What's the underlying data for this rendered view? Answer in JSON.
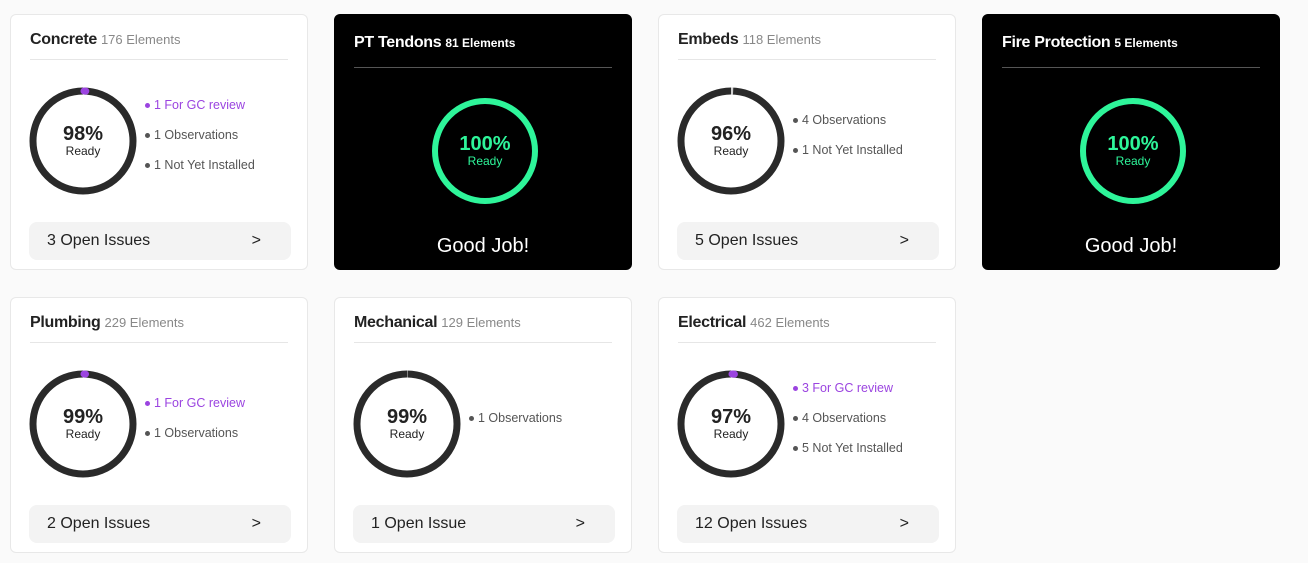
{
  "colors": {
    "track": "#2a2a2a",
    "gap": "#d0d0d0",
    "review": "#9b44e0",
    "good": "#2ef59a"
  },
  "cards": [
    {
      "title": "Concrete",
      "count": "176 Elements",
      "percent": "98%",
      "ready": "Ready",
      "ready_fraction": 0.98,
      "review_fraction": 0.006,
      "legend": [
        {
          "label": "1 For GC review",
          "type": "review"
        },
        {
          "label": "1 Observations",
          "type": "normal"
        },
        {
          "label": "1 Not Yet Installed",
          "type": "normal"
        }
      ],
      "issues": "3 Open Issues"
    },
    {
      "title": "PT Tendons",
      "count": "81 Elements",
      "percent": "100%",
      "ready": "Ready",
      "ready_fraction": 1,
      "dark": true,
      "message": "Good Job!"
    },
    {
      "title": "Embeds",
      "count": "118 Elements",
      "percent": "96%",
      "ready": "Ready",
      "ready_fraction": 0.96,
      "review_fraction": 0,
      "legend": [
        {
          "label": "4 Observations",
          "type": "normal"
        },
        {
          "label": "1 Not Yet Installed",
          "type": "normal"
        }
      ],
      "issues": "5 Open Issues"
    },
    {
      "title": "Fire Protection",
      "count": "5 Elements",
      "percent": "100%",
      "ready": "Ready",
      "ready_fraction": 1,
      "dark": true,
      "message": "Good Job!"
    },
    {
      "title": "Plumbing",
      "count": "229 Elements",
      "percent": "99%",
      "ready": "Ready",
      "ready_fraction": 0.99,
      "review_fraction": 0.005,
      "legend": [
        {
          "label": "1 For GC review",
          "type": "review"
        },
        {
          "label": "1 Observations",
          "type": "normal"
        }
      ],
      "issues": "2 Open Issues"
    },
    {
      "title": "Mechanical",
      "count": "129 Elements",
      "percent": "99%",
      "ready": "Ready",
      "ready_fraction": 0.99,
      "review_fraction": 0,
      "legend": [
        {
          "label": "1 Observations",
          "type": "normal"
        }
      ],
      "issues": "1 Open Issue"
    },
    {
      "title": "Electrical",
      "count": "462 Elements",
      "percent": "97%",
      "ready": "Ready",
      "ready_fraction": 0.97,
      "review_fraction": 0.008,
      "legend": [
        {
          "label": "3 For GC review",
          "type": "review"
        },
        {
          "label": "4 Observations",
          "type": "normal"
        },
        {
          "label": "5 Not Yet Installed",
          "type": "normal"
        }
      ],
      "issues": "12 Open Issues"
    }
  ]
}
